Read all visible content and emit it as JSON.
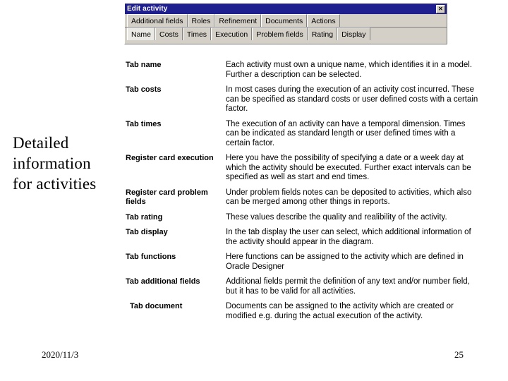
{
  "slide": {
    "heading_lines": [
      "Detailed",
      "information",
      "for activities"
    ],
    "crop_remnant": "",
    "footer": {
      "date": "2020/11/3",
      "page_number": "25"
    }
  },
  "dialog": {
    "title": "Edit activity",
    "close_label": "✕",
    "tab_rows": [
      {
        "tabs": [
          {
            "label": "Additional fields",
            "selected": false
          },
          {
            "label": "Roles",
            "selected": false
          },
          {
            "label": "Refinement",
            "selected": false
          },
          {
            "label": "Documents",
            "selected": false
          },
          {
            "label": "Actions",
            "selected": false
          }
        ]
      },
      {
        "tabs": [
          {
            "label": "Name",
            "selected": true
          },
          {
            "label": "Costs",
            "selected": false
          },
          {
            "label": "Times",
            "selected": false
          },
          {
            "label": "Execution",
            "selected": false
          },
          {
            "label": "Problem fields",
            "selected": false
          },
          {
            "label": "Rating",
            "selected": false
          },
          {
            "label": "Display",
            "selected": false
          }
        ]
      }
    ]
  },
  "definitions": [
    {
      "term": "Tab name",
      "indented": false,
      "description": "Each activity must own a unique name, which identifies it in a model. Further a description can be selected."
    },
    {
      "term": "Tab costs",
      "indented": false,
      "description": "In most cases during the execution of an activity cost incurred. These can be specified as standard costs or user defined costs with a certain factor."
    },
    {
      "term": "Tab times",
      "indented": false,
      "description": "The execution of an activity can have a temporal dimension. Times can be indicated as standard length or user defined times with a certain factor."
    },
    {
      "term": "Register card execution",
      "indented": false,
      "description": "Here you have the possibility of specifying a date or a week day at which the activity should be executed. Further exact intervals can be specified as well as start and end times."
    },
    {
      "term": "Register card problem fields",
      "indented": false,
      "description": "Under problem fields notes can be deposited to activities, which also can be merged among other things in reports."
    },
    {
      "term": "Tab rating",
      "indented": false,
      "description": "These values describe the quality and realibility of the activity."
    },
    {
      "term": "Tab display",
      "indented": false,
      "description": "In the tab display the user can select, which additional information of the activity should appear in the diagram."
    },
    {
      "term": "Tab functions",
      "indented": false,
      "description": "Here functions can be assigned to the activity which are defined in Oracle Designer"
    },
    {
      "term": "Tab additional fields",
      "indented": false,
      "description": "Additional fields permit the definition of any  text and/or number field, but it has to be valid for all activities."
    },
    {
      "term": "Tab document",
      "indented": true,
      "description": "Documents can be assigned to the activity which are created or modified e.g. during the actual execution of the activity."
    }
  ]
}
